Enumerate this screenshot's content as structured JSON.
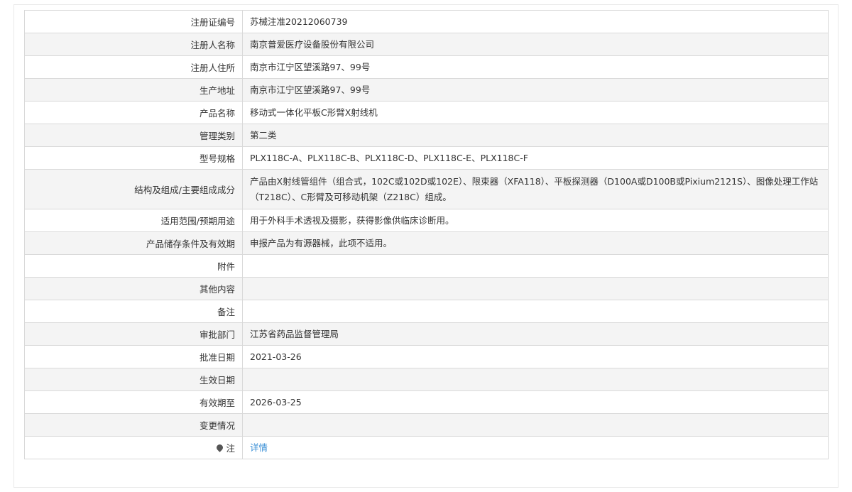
{
  "rows": [
    {
      "label": "注册证编号",
      "value": "苏械注准20212060739"
    },
    {
      "label": "注册人名称",
      "value": "南京普爱医疗设备股份有限公司"
    },
    {
      "label": "注册人住所",
      "value": "南京市江宁区望溪路97、99号"
    },
    {
      "label": "生产地址",
      "value": "南京市江宁区望溪路97、99号"
    },
    {
      "label": "产品名称",
      "value": "移动式一体化平板C形臂X射线机"
    },
    {
      "label": "管理类别",
      "value": "第二类"
    },
    {
      "label": "型号规格",
      "value": "PLX118C-A、PLX118C-B、PLX118C-D、PLX118C-E、PLX118C-F"
    },
    {
      "label": "结构及组成/主要组成成分",
      "value": "产品由X射线管组件（组合式，102C或102D或102E）、限束器（XFA118）、平板探测器（D100A或D100B或Pixium2121S）、图像处理工作站（T218C）、C形臂及可移动机架（Z218C）组成。"
    },
    {
      "label": "适用范围/预期用途",
      "value": "用于外科手术透视及摄影，获得影像供临床诊断用。"
    },
    {
      "label": "产品储存条件及有效期",
      "value": "申报产品为有源器械，此项不适用。"
    },
    {
      "label": "附件",
      "value": ""
    },
    {
      "label": "其他内容",
      "value": ""
    },
    {
      "label": "备注",
      "value": ""
    },
    {
      "label": "审批部门",
      "value": "江苏省药品监督管理局"
    },
    {
      "label": "批准日期",
      "value": "2021-03-26"
    },
    {
      "label": "生效日期",
      "value": ""
    },
    {
      "label": "有效期至",
      "value": "2026-03-25"
    },
    {
      "label": "变更情况",
      "value": ""
    }
  ],
  "note": {
    "label": "注",
    "icon": "map-pin-icon",
    "link_text": "详情",
    "link_color": "#3a8fd6"
  }
}
